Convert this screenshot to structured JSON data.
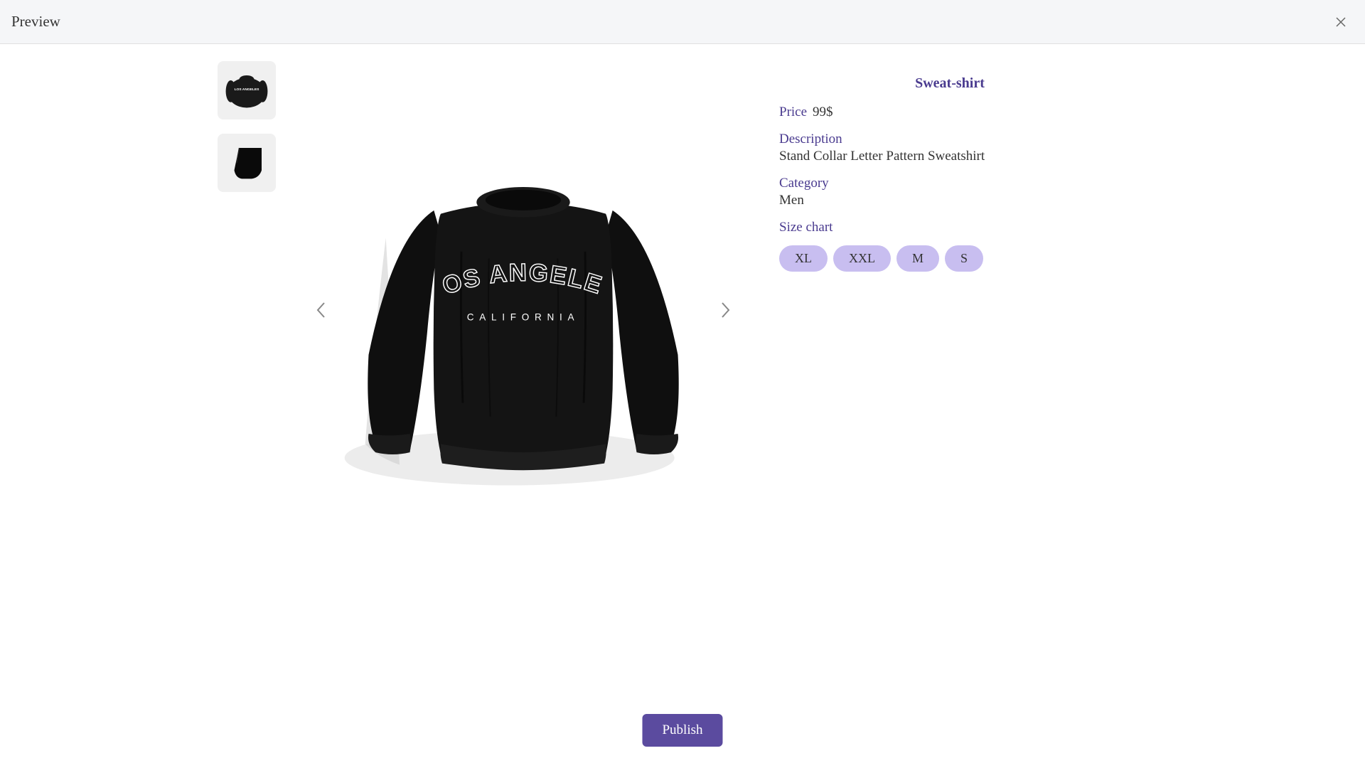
{
  "header": {
    "title": "Preview"
  },
  "product": {
    "title": "Sweat-shirt",
    "price_label": "Price",
    "price_value": "99$",
    "description_label": "Description",
    "description_value": "Stand Collar Letter Pattern Sweatshirt",
    "category_label": "Category",
    "category_value": "Men",
    "size_chart_label": "Size chart",
    "sizes": [
      "XL",
      "XXL",
      "M",
      "S"
    ],
    "graphic_text_main": "LOS ANGELES",
    "graphic_text_sub": "CALIFORNIA"
  },
  "actions": {
    "publish_label": "Publish"
  },
  "colors": {
    "accent": "#4a3b8f",
    "pill_bg": "#c8bef0",
    "button_bg": "#5b4b9f"
  }
}
